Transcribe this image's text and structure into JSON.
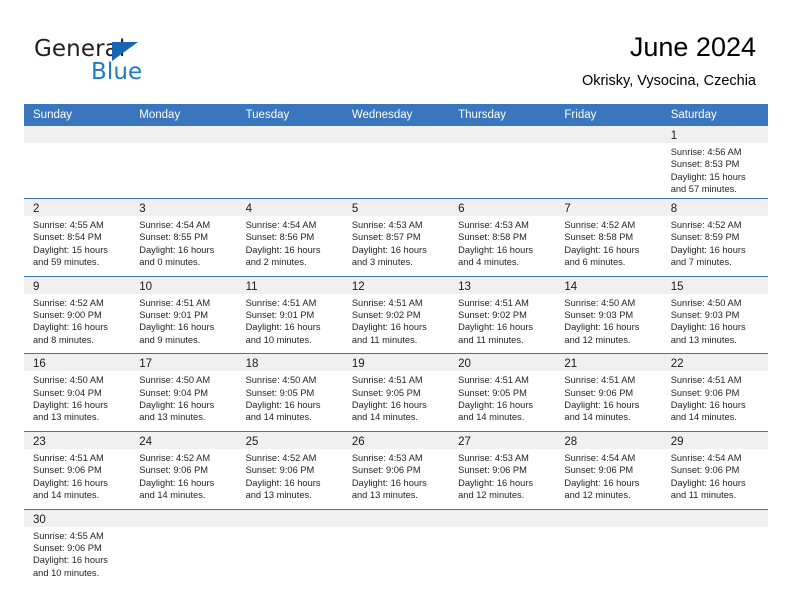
{
  "brand": {
    "name_top": "General",
    "name_bottom": "Blue",
    "triangle_color": "#1567b2",
    "blue_color": "#1b7dc4"
  },
  "header": {
    "title": "June 2024",
    "location": "Okrisky, Vysocina, Czechia"
  },
  "theme": {
    "header_blue": "#3a76bd",
    "daynum_band": "#f0f0f0",
    "text": "#231f20"
  },
  "weekdays": [
    "Sunday",
    "Monday",
    "Tuesday",
    "Wednesday",
    "Thursday",
    "Friday",
    "Saturday"
  ],
  "weeks": [
    [
      {
        "day": "",
        "empty": true
      },
      {
        "day": "",
        "empty": true
      },
      {
        "day": "",
        "empty": true
      },
      {
        "day": "",
        "empty": true
      },
      {
        "day": "",
        "empty": true
      },
      {
        "day": "",
        "empty": true
      },
      {
        "day": "1",
        "sunrise": "Sunrise: 4:56 AM",
        "sunset": "Sunset: 8:53 PM",
        "daylight1": "Daylight: 15 hours",
        "daylight2": "and 57 minutes."
      }
    ],
    [
      {
        "day": "2",
        "sunrise": "Sunrise: 4:55 AM",
        "sunset": "Sunset: 8:54 PM",
        "daylight1": "Daylight: 15 hours",
        "daylight2": "and 59 minutes."
      },
      {
        "day": "3",
        "sunrise": "Sunrise: 4:54 AM",
        "sunset": "Sunset: 8:55 PM",
        "daylight1": "Daylight: 16 hours",
        "daylight2": "and 0 minutes."
      },
      {
        "day": "4",
        "sunrise": "Sunrise: 4:54 AM",
        "sunset": "Sunset: 8:56 PM",
        "daylight1": "Daylight: 16 hours",
        "daylight2": "and 2 minutes."
      },
      {
        "day": "5",
        "sunrise": "Sunrise: 4:53 AM",
        "sunset": "Sunset: 8:57 PM",
        "daylight1": "Daylight: 16 hours",
        "daylight2": "and 3 minutes."
      },
      {
        "day": "6",
        "sunrise": "Sunrise: 4:53 AM",
        "sunset": "Sunset: 8:58 PM",
        "daylight1": "Daylight: 16 hours",
        "daylight2": "and 4 minutes."
      },
      {
        "day": "7",
        "sunrise": "Sunrise: 4:52 AM",
        "sunset": "Sunset: 8:58 PM",
        "daylight1": "Daylight: 16 hours",
        "daylight2": "and 6 minutes."
      },
      {
        "day": "8",
        "sunrise": "Sunrise: 4:52 AM",
        "sunset": "Sunset: 8:59 PM",
        "daylight1": "Daylight: 16 hours",
        "daylight2": "and 7 minutes."
      }
    ],
    [
      {
        "day": "9",
        "sunrise": "Sunrise: 4:52 AM",
        "sunset": "Sunset: 9:00 PM",
        "daylight1": "Daylight: 16 hours",
        "daylight2": "and 8 minutes."
      },
      {
        "day": "10",
        "sunrise": "Sunrise: 4:51 AM",
        "sunset": "Sunset: 9:01 PM",
        "daylight1": "Daylight: 16 hours",
        "daylight2": "and 9 minutes."
      },
      {
        "day": "11",
        "sunrise": "Sunrise: 4:51 AM",
        "sunset": "Sunset: 9:01 PM",
        "daylight1": "Daylight: 16 hours",
        "daylight2": "and 10 minutes."
      },
      {
        "day": "12",
        "sunrise": "Sunrise: 4:51 AM",
        "sunset": "Sunset: 9:02 PM",
        "daylight1": "Daylight: 16 hours",
        "daylight2": "and 11 minutes."
      },
      {
        "day": "13",
        "sunrise": "Sunrise: 4:51 AM",
        "sunset": "Sunset: 9:02 PM",
        "daylight1": "Daylight: 16 hours",
        "daylight2": "and 11 minutes."
      },
      {
        "day": "14",
        "sunrise": "Sunrise: 4:50 AM",
        "sunset": "Sunset: 9:03 PM",
        "daylight1": "Daylight: 16 hours",
        "daylight2": "and 12 minutes."
      },
      {
        "day": "15",
        "sunrise": "Sunrise: 4:50 AM",
        "sunset": "Sunset: 9:03 PM",
        "daylight1": "Daylight: 16 hours",
        "daylight2": "and 13 minutes."
      }
    ],
    [
      {
        "day": "16",
        "sunrise": "Sunrise: 4:50 AM",
        "sunset": "Sunset: 9:04 PM",
        "daylight1": "Daylight: 16 hours",
        "daylight2": "and 13 minutes."
      },
      {
        "day": "17",
        "sunrise": "Sunrise: 4:50 AM",
        "sunset": "Sunset: 9:04 PM",
        "daylight1": "Daylight: 16 hours",
        "daylight2": "and 13 minutes."
      },
      {
        "day": "18",
        "sunrise": "Sunrise: 4:50 AM",
        "sunset": "Sunset: 9:05 PM",
        "daylight1": "Daylight: 16 hours",
        "daylight2": "and 14 minutes."
      },
      {
        "day": "19",
        "sunrise": "Sunrise: 4:51 AM",
        "sunset": "Sunset: 9:05 PM",
        "daylight1": "Daylight: 16 hours",
        "daylight2": "and 14 minutes."
      },
      {
        "day": "20",
        "sunrise": "Sunrise: 4:51 AM",
        "sunset": "Sunset: 9:05 PM",
        "daylight1": "Daylight: 16 hours",
        "daylight2": "and 14 minutes."
      },
      {
        "day": "21",
        "sunrise": "Sunrise: 4:51 AM",
        "sunset": "Sunset: 9:06 PM",
        "daylight1": "Daylight: 16 hours",
        "daylight2": "and 14 minutes."
      },
      {
        "day": "22",
        "sunrise": "Sunrise: 4:51 AM",
        "sunset": "Sunset: 9:06 PM",
        "daylight1": "Daylight: 16 hours",
        "daylight2": "and 14 minutes."
      }
    ],
    [
      {
        "day": "23",
        "sunrise": "Sunrise: 4:51 AM",
        "sunset": "Sunset: 9:06 PM",
        "daylight1": "Daylight: 16 hours",
        "daylight2": "and 14 minutes."
      },
      {
        "day": "24",
        "sunrise": "Sunrise: 4:52 AM",
        "sunset": "Sunset: 9:06 PM",
        "daylight1": "Daylight: 16 hours",
        "daylight2": "and 14 minutes."
      },
      {
        "day": "25",
        "sunrise": "Sunrise: 4:52 AM",
        "sunset": "Sunset: 9:06 PM",
        "daylight1": "Daylight: 16 hours",
        "daylight2": "and 13 minutes."
      },
      {
        "day": "26",
        "sunrise": "Sunrise: 4:53 AM",
        "sunset": "Sunset: 9:06 PM",
        "daylight1": "Daylight: 16 hours",
        "daylight2": "and 13 minutes."
      },
      {
        "day": "27",
        "sunrise": "Sunrise: 4:53 AM",
        "sunset": "Sunset: 9:06 PM",
        "daylight1": "Daylight: 16 hours",
        "daylight2": "and 12 minutes."
      },
      {
        "day": "28",
        "sunrise": "Sunrise: 4:54 AM",
        "sunset": "Sunset: 9:06 PM",
        "daylight1": "Daylight: 16 hours",
        "daylight2": "and 12 minutes."
      },
      {
        "day": "29",
        "sunrise": "Sunrise: 4:54 AM",
        "sunset": "Sunset: 9:06 PM",
        "daylight1": "Daylight: 16 hours",
        "daylight2": "and 11 minutes."
      }
    ],
    [
      {
        "day": "30",
        "sunrise": "Sunrise: 4:55 AM",
        "sunset": "Sunset: 9:06 PM",
        "daylight1": "Daylight: 16 hours",
        "daylight2": "and 10 minutes."
      },
      {
        "day": "",
        "empty": true
      },
      {
        "day": "",
        "empty": true
      },
      {
        "day": "",
        "empty": true
      },
      {
        "day": "",
        "empty": true
      },
      {
        "day": "",
        "empty": true
      },
      {
        "day": "",
        "empty": true
      }
    ]
  ]
}
